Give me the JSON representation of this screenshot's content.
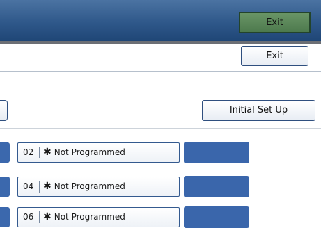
{
  "header": {
    "exit_label": "Exit"
  },
  "subheader": {
    "exit_label": "Exit"
  },
  "toolbar": {
    "initial_setup_label": "Initial Set Up"
  },
  "programs": [
    {
      "number": "02",
      "mark": "✱",
      "label": "Not Programmed"
    },
    {
      "number": "04",
      "mark": "✱",
      "label": "Not Programmed"
    },
    {
      "number": "06",
      "mark": "✱",
      "label": "Not Programmed"
    }
  ],
  "colors": {
    "header_blue": "#2f588a",
    "exit_green": "#5a875a",
    "slot_blue": "#3a66ab",
    "button_border": "#2f4f7f"
  }
}
